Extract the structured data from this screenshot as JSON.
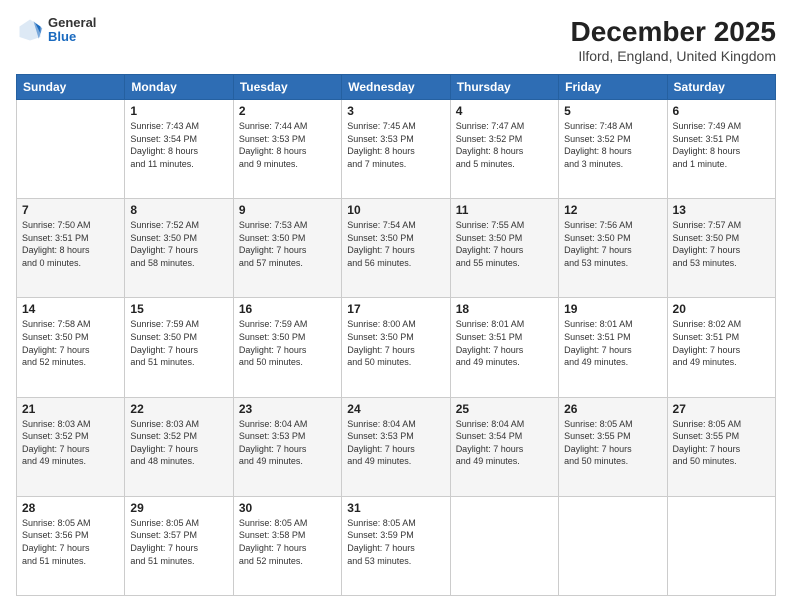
{
  "header": {
    "logo": {
      "general": "General",
      "blue": "Blue"
    },
    "title": "December 2025",
    "subtitle": "Ilford, England, United Kingdom"
  },
  "weekdays": [
    "Sunday",
    "Monday",
    "Tuesday",
    "Wednesday",
    "Thursday",
    "Friday",
    "Saturday"
  ],
  "weeks": [
    [
      {
        "day": "",
        "info": ""
      },
      {
        "day": "1",
        "info": "Sunrise: 7:43 AM\nSunset: 3:54 PM\nDaylight: 8 hours\nand 11 minutes."
      },
      {
        "day": "2",
        "info": "Sunrise: 7:44 AM\nSunset: 3:53 PM\nDaylight: 8 hours\nand 9 minutes."
      },
      {
        "day": "3",
        "info": "Sunrise: 7:45 AM\nSunset: 3:53 PM\nDaylight: 8 hours\nand 7 minutes."
      },
      {
        "day": "4",
        "info": "Sunrise: 7:47 AM\nSunset: 3:52 PM\nDaylight: 8 hours\nand 5 minutes."
      },
      {
        "day": "5",
        "info": "Sunrise: 7:48 AM\nSunset: 3:52 PM\nDaylight: 8 hours\nand 3 minutes."
      },
      {
        "day": "6",
        "info": "Sunrise: 7:49 AM\nSunset: 3:51 PM\nDaylight: 8 hours\nand 1 minute."
      }
    ],
    [
      {
        "day": "7",
        "info": "Sunrise: 7:50 AM\nSunset: 3:51 PM\nDaylight: 8 hours\nand 0 minutes."
      },
      {
        "day": "8",
        "info": "Sunrise: 7:52 AM\nSunset: 3:50 PM\nDaylight: 7 hours\nand 58 minutes."
      },
      {
        "day": "9",
        "info": "Sunrise: 7:53 AM\nSunset: 3:50 PM\nDaylight: 7 hours\nand 57 minutes."
      },
      {
        "day": "10",
        "info": "Sunrise: 7:54 AM\nSunset: 3:50 PM\nDaylight: 7 hours\nand 56 minutes."
      },
      {
        "day": "11",
        "info": "Sunrise: 7:55 AM\nSunset: 3:50 PM\nDaylight: 7 hours\nand 55 minutes."
      },
      {
        "day": "12",
        "info": "Sunrise: 7:56 AM\nSunset: 3:50 PM\nDaylight: 7 hours\nand 53 minutes."
      },
      {
        "day": "13",
        "info": "Sunrise: 7:57 AM\nSunset: 3:50 PM\nDaylight: 7 hours\nand 53 minutes."
      }
    ],
    [
      {
        "day": "14",
        "info": "Sunrise: 7:58 AM\nSunset: 3:50 PM\nDaylight: 7 hours\nand 52 minutes."
      },
      {
        "day": "15",
        "info": "Sunrise: 7:59 AM\nSunset: 3:50 PM\nDaylight: 7 hours\nand 51 minutes."
      },
      {
        "day": "16",
        "info": "Sunrise: 7:59 AM\nSunset: 3:50 PM\nDaylight: 7 hours\nand 50 minutes."
      },
      {
        "day": "17",
        "info": "Sunrise: 8:00 AM\nSunset: 3:50 PM\nDaylight: 7 hours\nand 50 minutes."
      },
      {
        "day": "18",
        "info": "Sunrise: 8:01 AM\nSunset: 3:51 PM\nDaylight: 7 hours\nand 49 minutes."
      },
      {
        "day": "19",
        "info": "Sunrise: 8:01 AM\nSunset: 3:51 PM\nDaylight: 7 hours\nand 49 minutes."
      },
      {
        "day": "20",
        "info": "Sunrise: 8:02 AM\nSunset: 3:51 PM\nDaylight: 7 hours\nand 49 minutes."
      }
    ],
    [
      {
        "day": "21",
        "info": "Sunrise: 8:03 AM\nSunset: 3:52 PM\nDaylight: 7 hours\nand 49 minutes."
      },
      {
        "day": "22",
        "info": "Sunrise: 8:03 AM\nSunset: 3:52 PM\nDaylight: 7 hours\nand 48 minutes."
      },
      {
        "day": "23",
        "info": "Sunrise: 8:04 AM\nSunset: 3:53 PM\nDaylight: 7 hours\nand 49 minutes."
      },
      {
        "day": "24",
        "info": "Sunrise: 8:04 AM\nSunset: 3:53 PM\nDaylight: 7 hours\nand 49 minutes."
      },
      {
        "day": "25",
        "info": "Sunrise: 8:04 AM\nSunset: 3:54 PM\nDaylight: 7 hours\nand 49 minutes."
      },
      {
        "day": "26",
        "info": "Sunrise: 8:05 AM\nSunset: 3:55 PM\nDaylight: 7 hours\nand 50 minutes."
      },
      {
        "day": "27",
        "info": "Sunrise: 8:05 AM\nSunset: 3:55 PM\nDaylight: 7 hours\nand 50 minutes."
      }
    ],
    [
      {
        "day": "28",
        "info": "Sunrise: 8:05 AM\nSunset: 3:56 PM\nDaylight: 7 hours\nand 51 minutes."
      },
      {
        "day": "29",
        "info": "Sunrise: 8:05 AM\nSunset: 3:57 PM\nDaylight: 7 hours\nand 51 minutes."
      },
      {
        "day": "30",
        "info": "Sunrise: 8:05 AM\nSunset: 3:58 PM\nDaylight: 7 hours\nand 52 minutes."
      },
      {
        "day": "31",
        "info": "Sunrise: 8:05 AM\nSunset: 3:59 PM\nDaylight: 7 hours\nand 53 minutes."
      },
      {
        "day": "",
        "info": ""
      },
      {
        "day": "",
        "info": ""
      },
      {
        "day": "",
        "info": ""
      }
    ]
  ]
}
